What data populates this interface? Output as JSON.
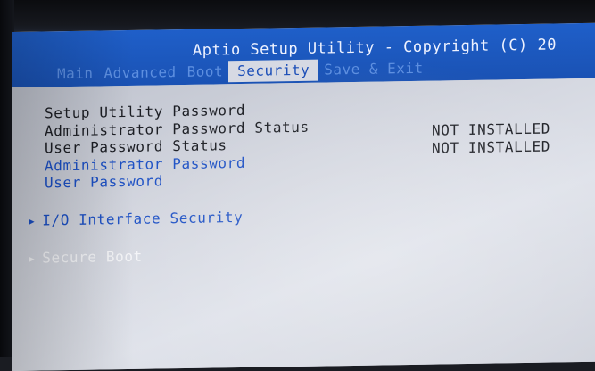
{
  "header": {
    "title": "Aptio Setup Utility - Copyright (C) 20"
  },
  "tabs": [
    {
      "label": "Main",
      "active": false
    },
    {
      "label": "Advanced",
      "active": false
    },
    {
      "label": "Boot",
      "active": false
    },
    {
      "label": "Security",
      "active": true
    },
    {
      "label": "Save & Exit",
      "active": false
    }
  ],
  "security": {
    "setup_utility_password_label": "Setup Utility Password",
    "admin_password_status_label": "Administrator Password Status",
    "admin_password_status_value": "NOT INSTALLED",
    "user_password_status_label": "User Password Status",
    "user_password_status_value": "NOT INSTALLED",
    "admin_password_label": "Administrator Password",
    "user_password_label": "User Password",
    "io_interface_security_label": "I/O Interface Security",
    "secure_boot_label": "Secure Boot"
  },
  "colors": {
    "header_blue": "#1f5fc9",
    "selectable_blue": "#1b4fc4",
    "panel_gray": "#d3d6df"
  }
}
